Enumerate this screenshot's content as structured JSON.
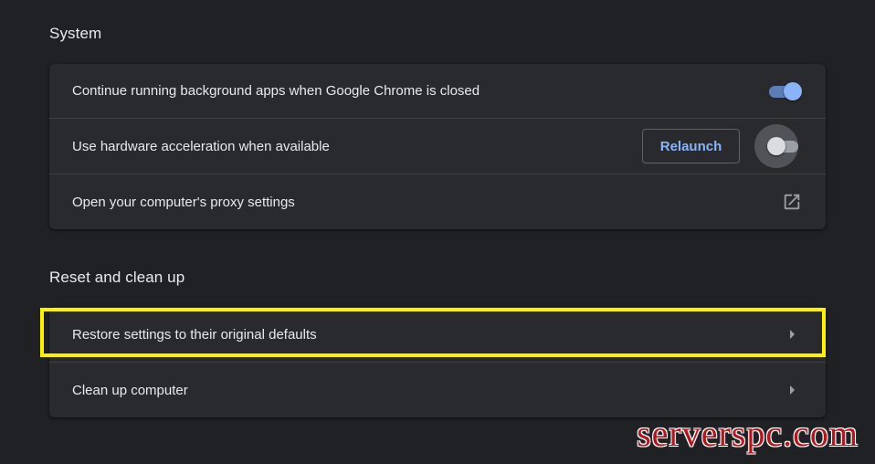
{
  "system": {
    "title": "System",
    "rows": [
      {
        "label": "Continue running background apps when Google Chrome is closed",
        "toggle": "on"
      },
      {
        "label": "Use hardware acceleration when available",
        "button": "Relaunch",
        "toggle": "off"
      },
      {
        "label": "Open your computer's proxy settings",
        "icon": "open-in-new-icon"
      }
    ]
  },
  "reset": {
    "title": "Reset and clean up",
    "rows": [
      {
        "label": "Restore settings to their original defaults",
        "icon": "arrow-right-icon"
      },
      {
        "label": "Clean up computer",
        "icon": "arrow-right-icon"
      }
    ]
  },
  "watermark": "serverspc.com",
  "colors": {
    "background": "#202124",
    "card": "#292a2d",
    "accent": "#8ab4f8",
    "highlight": "#fff200",
    "watermark": "#b0171f"
  }
}
